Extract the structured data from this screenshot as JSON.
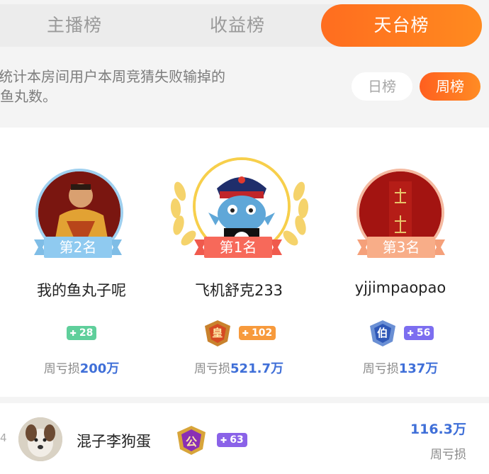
{
  "tabs": [
    {
      "label": "主播榜",
      "active": false
    },
    {
      "label": "收益榜",
      "active": false
    },
    {
      "label": "天台榜",
      "active": true
    }
  ],
  "description": {
    "line1": "统计本房间用户本周竞猜失败输掉的",
    "line2": "鱼丸数。"
  },
  "range": {
    "day_label": "日榜",
    "week_label": "周榜",
    "selected": "周榜"
  },
  "podium": [
    {
      "rank_label": "第2名",
      "name": "我的鱼丸子呢",
      "level": "28",
      "level_color": "#5fcf9b",
      "loss_label": "周亏损",
      "loss_value": "200万"
    },
    {
      "rank_label": "第1名",
      "name": "飞机舒克233",
      "badge_char": "皇",
      "level": "102",
      "level_color": "#f79a3c",
      "loss_label": "周亏损",
      "loss_value": "521.7万"
    },
    {
      "rank_label": "第3名",
      "name": "yjjimpaopao",
      "badge_char": "伯",
      "level": "56",
      "level_color": "#7c6ef0",
      "loss_label": "周亏损",
      "loss_value": "137万"
    }
  ],
  "list": [
    {
      "index": "4",
      "name": "混子李狗蛋",
      "badge_char": "公",
      "level": "63",
      "level_color": "#8a62e8",
      "amount": "116.3万",
      "amount_label": "周亏损"
    }
  ],
  "colors": {
    "accent": "#ff6d1f",
    "amount": "#3f6fd8"
  }
}
